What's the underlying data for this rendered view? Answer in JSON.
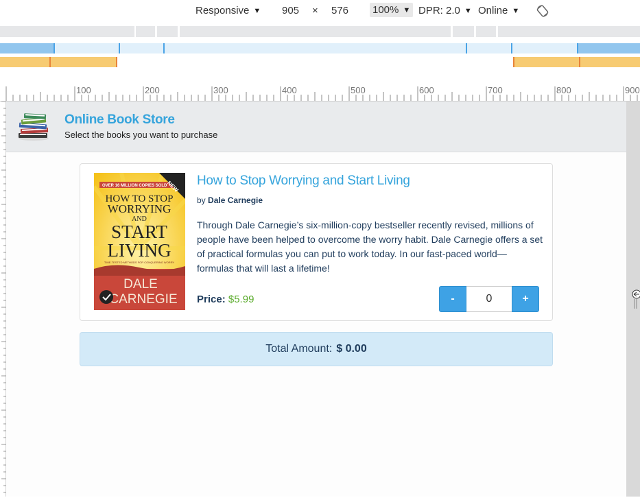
{
  "devtools": {
    "device": "Responsive",
    "width": "905",
    "times": "×",
    "height": "576",
    "zoom": "100%",
    "dpr": "DPR: 2.0",
    "network": "Online",
    "ruler_labels": [
      "100",
      "200",
      "300",
      "400",
      "500",
      "600",
      "700",
      "800",
      "900"
    ],
    "colors": {
      "mq_gray": "#e6e7e9",
      "mq_blue": "#92c6ee",
      "mq_blue_light": "#e1f0fb",
      "mq_orange": "#f7cb72"
    }
  },
  "site": {
    "title": "Online Book Store",
    "subtitle": "Select the books you want to purchase",
    "logo_icon": "book-stack-icon"
  },
  "book": {
    "title": "How to Stop Worrying and Start Living",
    "by_label": "by",
    "author": "Dale Carnegie",
    "description": "Through Dale Carnegie’s six-million-copy bestseller recently revised, millions of people have been helped to overcome the worry habit. Dale Carnegie offers a set of practical formulas you can put to work today. In our fast-paced world—formulas that will last a lifetime!",
    "price_label": "Price:",
    "price": "$5.99",
    "quantity": "0",
    "minus_label": "-",
    "plus_label": "+",
    "cover": {
      "banner": "OVER 16 MILLION COPIES SOLD",
      "badge": "NEW",
      "title_lines": [
        "HOW TO STOP",
        "WORRYING",
        "AND",
        "START",
        "LIVING"
      ],
      "tagline": "TIME-TESTED METHODS FOR CONQUERING WORRY",
      "author_lines": [
        "DALE",
        "CARNEGIE"
      ]
    }
  },
  "total": {
    "label": "Total Amount:",
    "value": "$ 0.00"
  },
  "colors": {
    "accent": "#35a4dc",
    "price_green": "#5cac2e",
    "button_blue": "#3ea2e5",
    "total_bg": "#d3eaf8"
  }
}
